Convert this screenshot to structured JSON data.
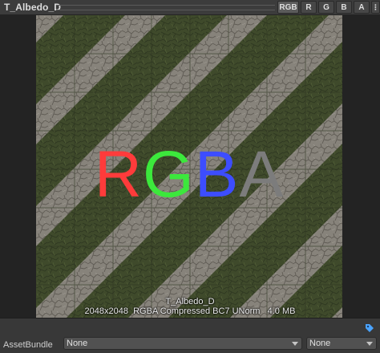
{
  "header": {
    "title": "T_Albedo_D",
    "channels": [
      "RGB",
      "R",
      "G",
      "B",
      "A"
    ]
  },
  "preview": {
    "overlay_letters": [
      {
        "char": "R",
        "color": "#ff3b3b"
      },
      {
        "char": "G",
        "color": "#3ce83c"
      },
      {
        "char": "B",
        "color": "#3d4dff"
      },
      {
        "char": "A",
        "color": "#7c7c7c"
      }
    ],
    "info_line1": "T_Albedo_D",
    "info_line2": "2048x2048  RGBA Compressed BC7 UNorm   4.0 MB"
  },
  "footer": {
    "asset_bundle_label": "AssetBundle",
    "bundle_name": "None",
    "bundle_variant": "None",
    "icon": "tag-icon"
  },
  "colors": {
    "header_bg": "#3c3c3c",
    "footer_bg": "#383838",
    "grass": "#3f4a2b",
    "stone": "#86827a"
  }
}
